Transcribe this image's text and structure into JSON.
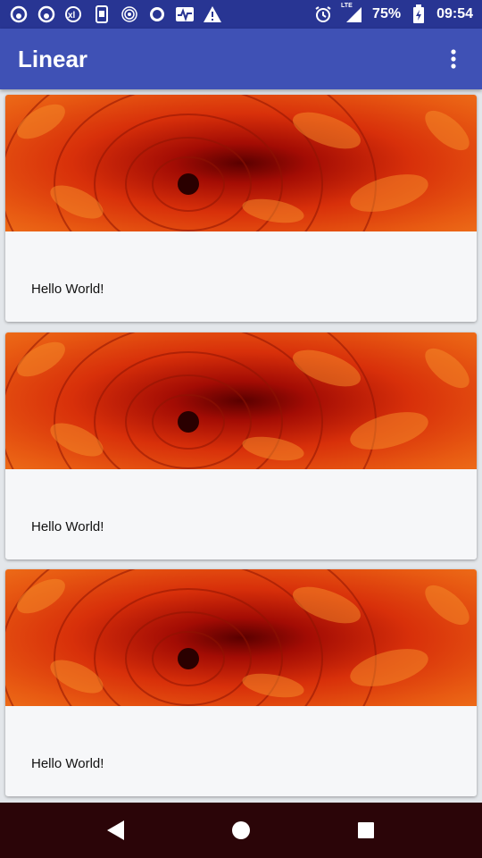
{
  "status_bar": {
    "battery_percent": "75%",
    "time": "09:54",
    "network_label": "LTE",
    "left_icons": [
      "app-notification-icon",
      "app-notification-icon",
      "xl-app-icon",
      "screenshot-icon",
      "spiral-app-icon",
      "circle-app-icon",
      "activity-icon",
      "warning-icon"
    ]
  },
  "app_bar": {
    "title": "Linear"
  },
  "cards": [
    {
      "text": "Hello World!"
    },
    {
      "text": "Hello World!"
    },
    {
      "text": "Hello World!"
    }
  ]
}
